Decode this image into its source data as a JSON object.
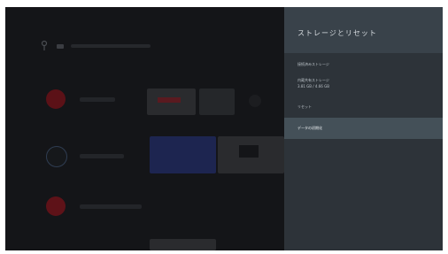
{
  "settings_panel": {
    "title": "ストレージとリセット",
    "items": [
      {
        "label": "接続済みストレージ"
      },
      {
        "label": "内蔵共有ストレージ",
        "detail": "3.81 GB / 4.66 GB"
      },
      {
        "label": "リセット"
      },
      {
        "label": "データの初期化"
      }
    ],
    "selected_index": 3
  },
  "colors": {
    "panel_bg": "#2d3339",
    "panel_header_bg": "#39424a",
    "selected_bg": "#445058",
    "home_bg": "#141518"
  },
  "icons": [
    "search-icon",
    "app-icon-red",
    "app-icon-blue",
    "app-icon-youtube"
  ]
}
